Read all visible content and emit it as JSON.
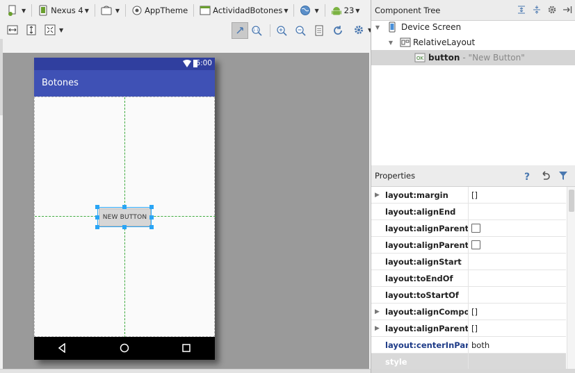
{
  "toolbar": {
    "device_label": "Nexus 4",
    "theme_label": "AppTheme",
    "activity_label": "ActividadBotones",
    "api_label": "23",
    "icons": [
      "new-layout-icon",
      "device-icon",
      "orientation-icon",
      "theme-icon",
      "activity-icon",
      "locale-icon",
      "android-icon"
    ]
  },
  "toolbar2": {
    "icons": [
      "expand-horizontal-icon",
      "expand-vertical-icon",
      "zoom-fit-icon",
      "pan-icon",
      "actual-size-icon",
      "zoom-in-icon",
      "zoom-out-icon",
      "page-icon",
      "refresh-icon",
      "settings-icon"
    ]
  },
  "phone": {
    "status_time": "6:00",
    "app_title": "Botones",
    "button_text": "NEW BUTTON",
    "nav_icons": [
      "back-icon",
      "home-icon",
      "recents-icon"
    ]
  },
  "component_tree": {
    "title": "Component Tree",
    "items": [
      {
        "label": "Device Screen",
        "icon": "device-screen-icon"
      },
      {
        "label": "RelativeLayout",
        "icon": "relative-layout-icon"
      },
      {
        "label": "button",
        "detail": "- \"New Button\"",
        "icon": "button-ok-icon"
      }
    ]
  },
  "properties": {
    "title": "Properties",
    "rows": [
      {
        "name": "layout:margin",
        "value": "[]",
        "expandable": true
      },
      {
        "name": "layout:alignEnd",
        "value": ""
      },
      {
        "name": "layout:alignParentEnd",
        "checkbox": true
      },
      {
        "name": "layout:alignParentStart",
        "checkbox": true
      },
      {
        "name": "layout:alignStart",
        "value": ""
      },
      {
        "name": "layout:toEndOf",
        "value": ""
      },
      {
        "name": "layout:toStartOf",
        "value": ""
      },
      {
        "name": "layout:alignComponent",
        "value": "[]",
        "expandable": true
      },
      {
        "name": "layout:alignParent",
        "value": "[]",
        "expandable": true
      },
      {
        "name": "layout:centerInParent",
        "value": "both",
        "highlight": true
      },
      {
        "name": "style",
        "value": ""
      }
    ]
  },
  "colors": {
    "accent": "#3f51b5",
    "status_bar": "#303f9f",
    "guide": "#3daa3d",
    "selection": "#29a5f5",
    "highlight_text": "#1f3c88"
  }
}
